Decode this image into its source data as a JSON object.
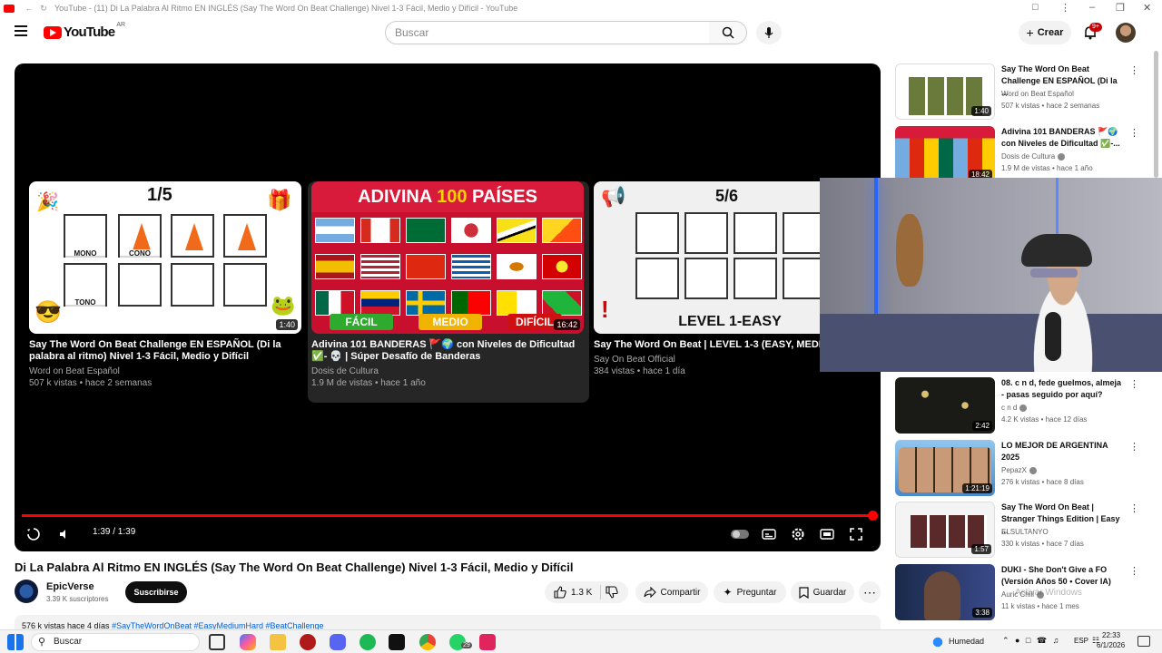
{
  "browser": {
    "tab_title": "YouTube - (11) Di La Palabra Al Ritmo EN INGLÉS (Say The Word On Beat Challenge) Nivel 1-3 Fácil, Medio y Difícil - YouTube"
  },
  "header": {
    "logo_text": "YouTube",
    "country_code": "AR",
    "search_placeholder": "Buscar",
    "create_label": "Crear",
    "notification_count": "9+"
  },
  "player": {
    "time": "1:39 / 1:39",
    "progress_fraction": 1.0,
    "end_screen": [
      {
        "title": "Say The Word On Beat Challenge EN ESPAÑOL (Di la palabra al ritmo) Nivel 1-3 Fácil, Medio y Difícil",
        "channel": "Word on Beat Español",
        "meta": "507 k vistas • hace 2 semanas",
        "duration": "1:40",
        "thumb_fraction": "1/5",
        "thumb_labels": [
          "MONO",
          "CONO",
          "TONO"
        ]
      },
      {
        "title": "Adivina 101 BANDERAS 🚩🌍 con Niveles de Dificultad ✅- 💀 | Súper Desafío de Banderas",
        "channel": "Dosis de Cultura",
        "meta": "1.9 M de vistas • hace 1 año",
        "duration": "16:42",
        "thumb_headline_a": "ADIVINA",
        "thumb_headline_b": "100",
        "thumb_headline_c": "PAÍSES",
        "thumb_levels": [
          "FÁCIL",
          "MEDIO",
          "DIFÍCIL"
        ]
      },
      {
        "title": "Say The Word On Beat | LEVEL 1-3 (EASY, MEDIUM",
        "channel": "Say On Beat Official",
        "meta": "384 vistas • hace 1 día",
        "thumb_fraction": "5/6",
        "thumb_level": "LEVEL 1-EASY"
      }
    ]
  },
  "video": {
    "title": "Di La Palabra Al Ritmo EN INGLÉS (Say The Word On Beat Challenge) Nivel 1-3 Fácil, Medio y Difícil",
    "channel": "EpicVerse",
    "subscribers": "3.39 K suscriptores",
    "subscribe_label": "Suscribirse",
    "likes": "1.3 K",
    "share_label": "Compartir",
    "ask_label": "Preguntar",
    "save_label": "Guardar",
    "description_stats": "576 k vistas  hace 4 días",
    "description_tags": "#SayTheWordOnBeat #EasyMediumHard #BeatChallenge"
  },
  "sidebar": [
    {
      "title": "Say The Word On Beat Challenge EN ESPAÑOL (Di la ...",
      "channel": "Word on Beat Español",
      "meta": "507 k vistas • hace 2 semanas",
      "duration": "1:40"
    },
    {
      "title": "Adivina 101 BANDERAS 🚩🌍 con Niveles de Dificultad ✅-...",
      "channel": "Dosis de Cultura",
      "meta": "1.9 M de vistas • hace 1 año",
      "duration": "18:42"
    },
    {
      "title": "08. c n d, fede guelmos, almeja - pasas seguido por aquí?",
      "channel": "c n d",
      "meta": "4.2 K vistas • hace 12 días",
      "duration": "2:42"
    },
    {
      "title": "LO MEJOR DE ARGENTINA 2025",
      "channel": "PepazX",
      "meta": "276 k vistas • hace 8 días",
      "duration": "1:21:19"
    },
    {
      "title": "Say The Word On Beat | Stranger Things Edition | Easy ...",
      "channel": "ELSULTANYO",
      "meta": "330 k vistas • hace 7 días",
      "duration": "1:57"
    },
    {
      "title": "DUKI - She Don't Give a FO (Versión Años 50 • Cover IA)",
      "channel": "Auric Chill",
      "meta": "11 k vistas • hace 1 mes",
      "duration": "3:38"
    }
  ],
  "overlay": {
    "watermark": "Activar Windows"
  },
  "taskbar": {
    "search_label": "Buscar",
    "whatsapp_badge": "29",
    "weather": "Humedad",
    "lang": "ESP",
    "time": "22:33",
    "date": "6/1/2026"
  },
  "colors": {
    "accent": "#ff0000",
    "player_bg": "#000000"
  }
}
